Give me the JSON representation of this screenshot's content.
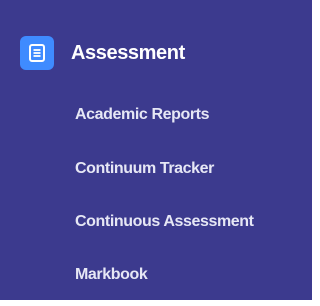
{
  "section": {
    "title": "Assessment",
    "icon": "assessment-document-icon",
    "accent_color": "#3f8bff",
    "background_color": "#3c3a8e"
  },
  "menu": {
    "items": [
      {
        "label": "Academic Reports"
      },
      {
        "label": "Continuum Tracker"
      },
      {
        "label": "Continuous Assessment"
      },
      {
        "label": "Markbook"
      }
    ]
  }
}
